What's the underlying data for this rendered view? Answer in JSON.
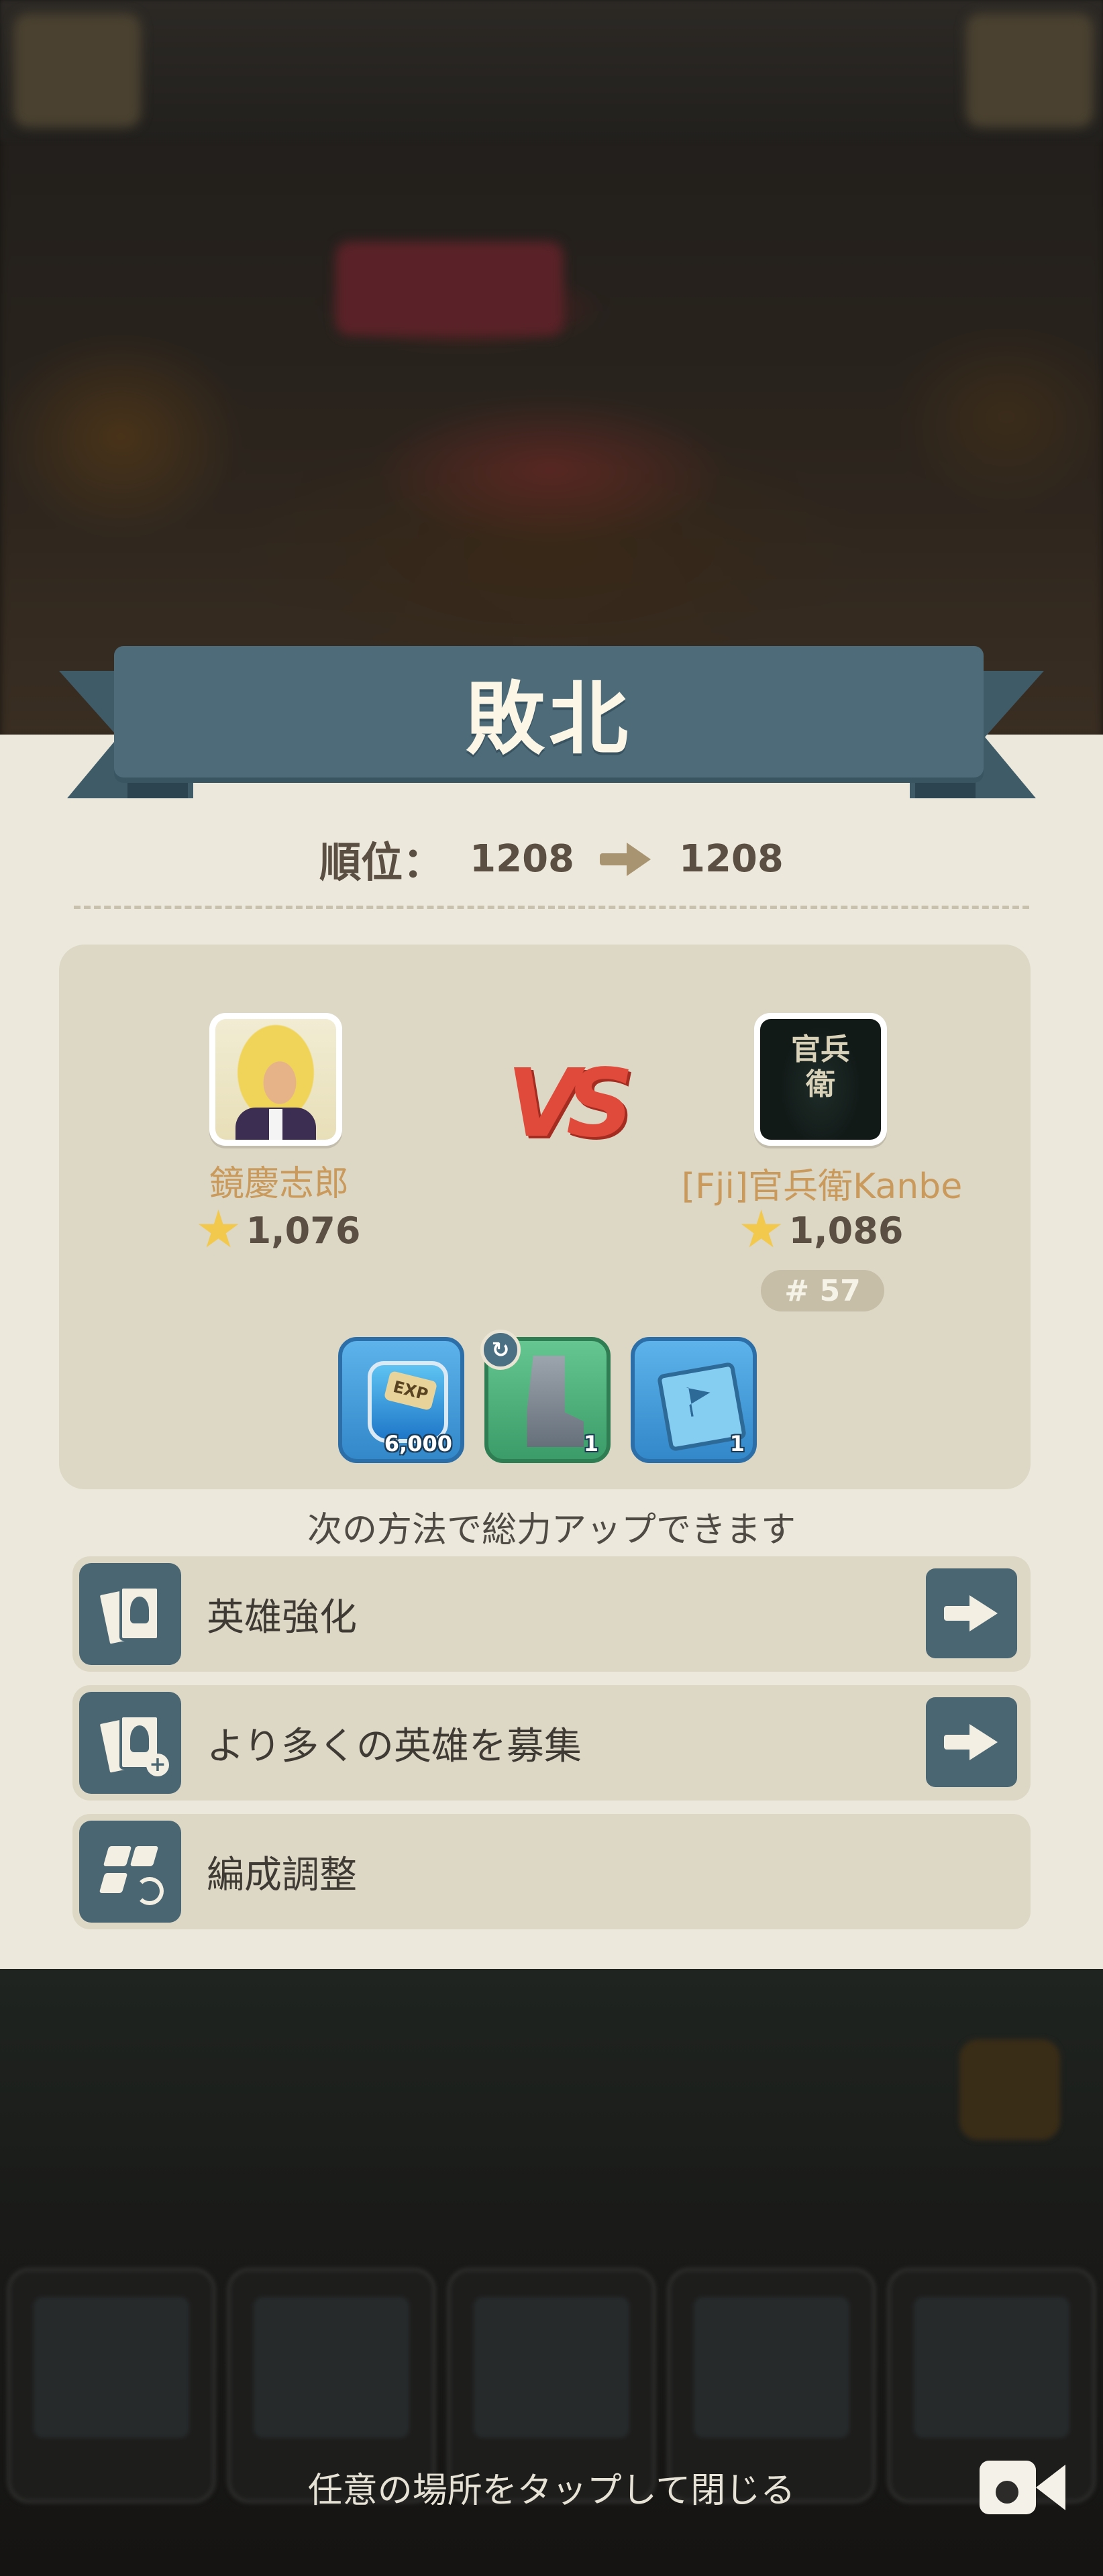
{
  "result": {
    "title": "敗北"
  },
  "rank": {
    "label": "順位：",
    "before": "1208",
    "after": "1208"
  },
  "players": {
    "left": {
      "name": "鏡慶志郎",
      "power": "1,076"
    },
    "right": {
      "name": "[Fji]官兵衛Kanbe",
      "power": "1,086",
      "rank_badge": "# 57",
      "avatar_text": "官兵衛"
    }
  },
  "vs_label": "VS",
  "rewards": [
    {
      "icon": "exp-potion-icon",
      "count": "6,000",
      "tag": "EXP"
    },
    {
      "icon": "boot-icon",
      "count": "1"
    },
    {
      "icon": "flag-book-icon",
      "count": "1"
    }
  ],
  "hint": "次の方法で総力アップできます",
  "actions": [
    {
      "label": "英雄強化",
      "icon": "hero-upgrade-icon"
    },
    {
      "label": "より多くの英雄を募集",
      "icon": "recruit-heroes-icon"
    },
    {
      "label": "編成調整",
      "icon": "formation-icon"
    }
  ],
  "close_hint": "任意の場所をタップして閉じる",
  "colors": {
    "ribbon": "#4d6b79",
    "panel": "#ece9dc",
    "box": "#ddd8c5",
    "name": "#c99a5c",
    "vs": "#e04a3b"
  }
}
